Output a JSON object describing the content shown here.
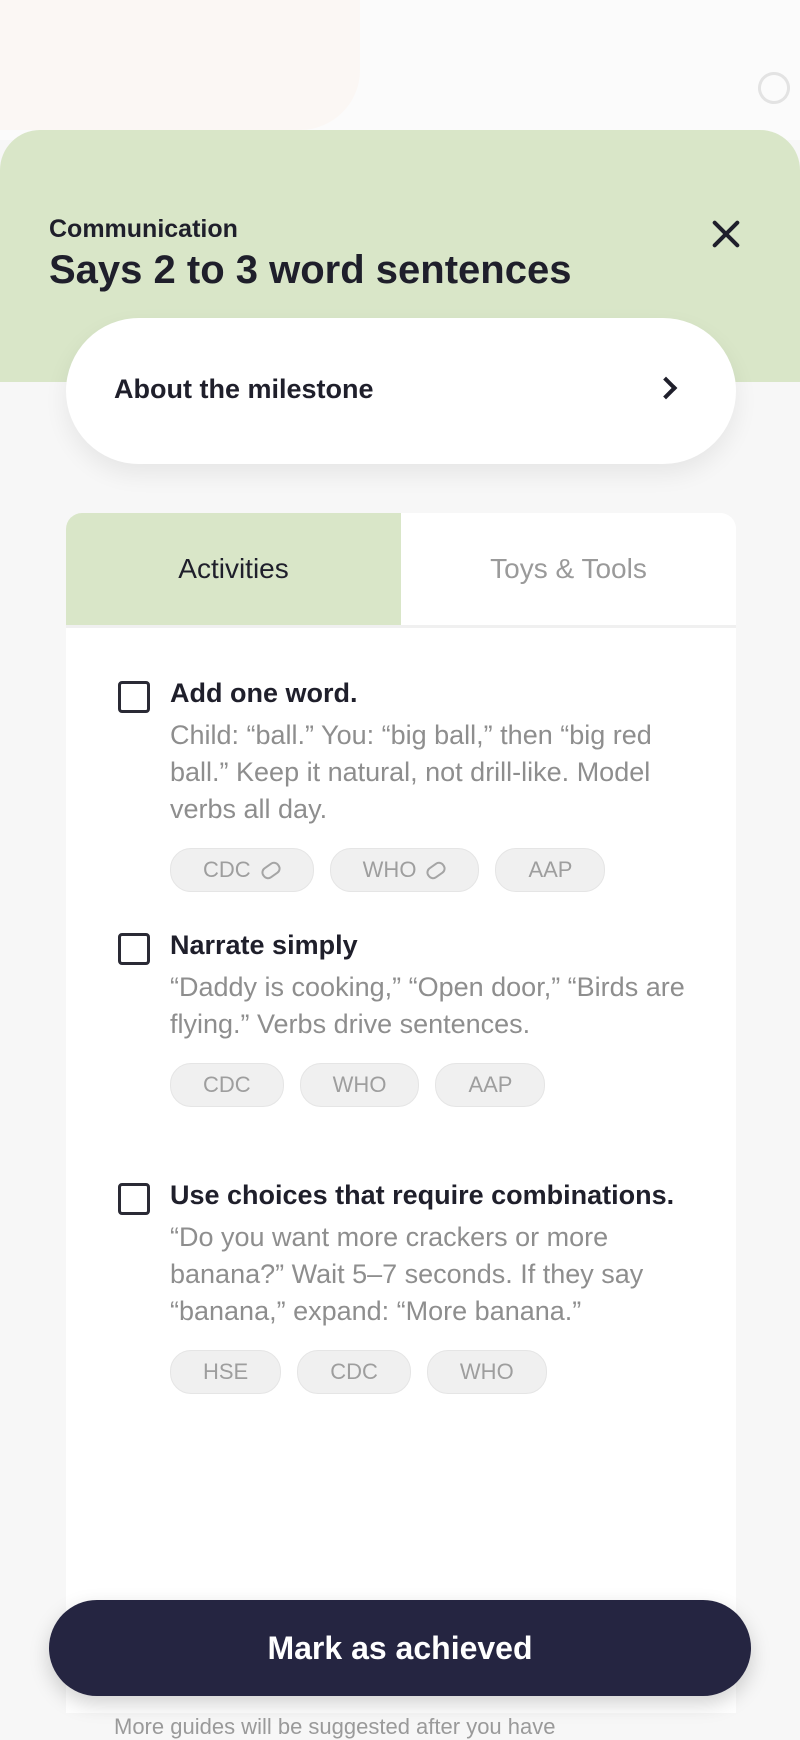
{
  "header": {
    "category": "Communication",
    "title": "Says 2 to 3 word sentences"
  },
  "about": {
    "label": "About the milestone"
  },
  "tabs": [
    {
      "label": "Activities",
      "active": true
    },
    {
      "label": "Toys & Tools",
      "active": false
    }
  ],
  "activities": [
    {
      "title": "Add one word.",
      "description": "Child: “ball.” You: “big ball,” then “big red ball.” Keep it natural, not drill-like. Model verbs all day.",
      "checked": false,
      "sources": [
        {
          "label": "CDC",
          "linked": true
        },
        {
          "label": "WHO",
          "linked": true
        },
        {
          "label": "AAP",
          "linked": false
        }
      ]
    },
    {
      "title": "Narrate simply",
      "description": "“Daddy is cooking,” “Open door,” “Birds are flying.” Verbs drive sentences.",
      "checked": false,
      "sources": [
        {
          "label": "CDC",
          "linked": false
        },
        {
          "label": "WHO",
          "linked": false
        },
        {
          "label": "AAP",
          "linked": false
        }
      ]
    },
    {
      "title": "Use choices that require combinations.",
      "description": "“Do you want more crackers or more banana?” Wait 5–7 seconds. If they say “banana,” expand: “More banana.”",
      "checked": false,
      "sources": [
        {
          "label": "HSE",
          "linked": false
        },
        {
          "label": "CDC",
          "linked": false
        },
        {
          "label": "WHO",
          "linked": false
        }
      ]
    }
  ],
  "cta": {
    "label": "Mark as achieved"
  },
  "footnote": "More guides will be suggested after you have",
  "colors": {
    "header_bg": "#d9e6c8",
    "cta_bg": "#252541",
    "muted_text": "#8e8e8e"
  },
  "icons": {
    "close": "close-icon",
    "chevron": "chevron-right-icon",
    "link": "link-icon"
  }
}
